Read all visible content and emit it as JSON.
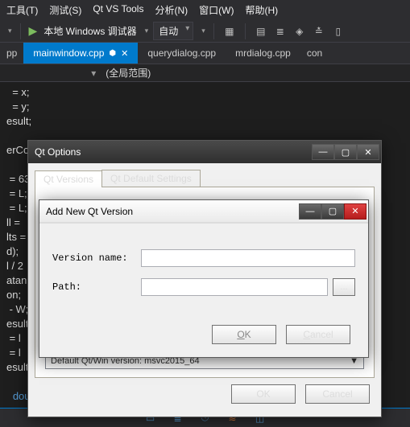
{
  "menu": {
    "tools": "工具(T)",
    "test": "测试(S)",
    "qtvstools": "Qt VS Tools",
    "analyze": "分析(N)",
    "window": "窗口(W)",
    "help": "帮助(H)"
  },
  "toolbar": {
    "debug_target": "本地 Windows 调试器",
    "config": "自动"
  },
  "tabs": {
    "left_overflow": "pp",
    "active": "mainwindow.cpp",
    "t2": "querydialog.cpp",
    "t3": "mrdialog.cpp",
    "right_overflow": "con"
  },
  "scope": {
    "label": "(全局范围)"
  },
  "code": {
    "l1": "  = x;",
    "l2": "  = y;",
    "l3": "esult;",
    "l4": "",
    "l5": "erCo",
    "l6": "",
    "l7": " = 63",
    "l8": " = L;",
    "l9": " = L;",
    "l10": "ll =",
    "l11": "lts =",
    "l12": "d);",
    "l13": "l / 2",
    "l14": "atan(",
    "l15": "on;",
    "l16": " - W;",
    "l17": "esult",
    "l18": " = l",
    "l19": " = l",
    "l20": "esult",
    "l21": "",
    "l22_kw": "doub"
  },
  "dlg_options": {
    "title": "Qt Options",
    "tab1": "Qt Versions",
    "tab2": "Qt Default Settings",
    "default_version": "Default Qt/Win version: msvc2015_64",
    "ok": "OK",
    "cancel": "Cancel"
  },
  "dlg_add": {
    "title": "Add New Qt Version",
    "label_name": "Version name:",
    "label_path": "Path:",
    "name_value": "",
    "path_value": "",
    "browse": "...",
    "ok_O": "O",
    "ok_K": "K",
    "cancel_C": "C",
    "cancel_rest": "ancel"
  }
}
